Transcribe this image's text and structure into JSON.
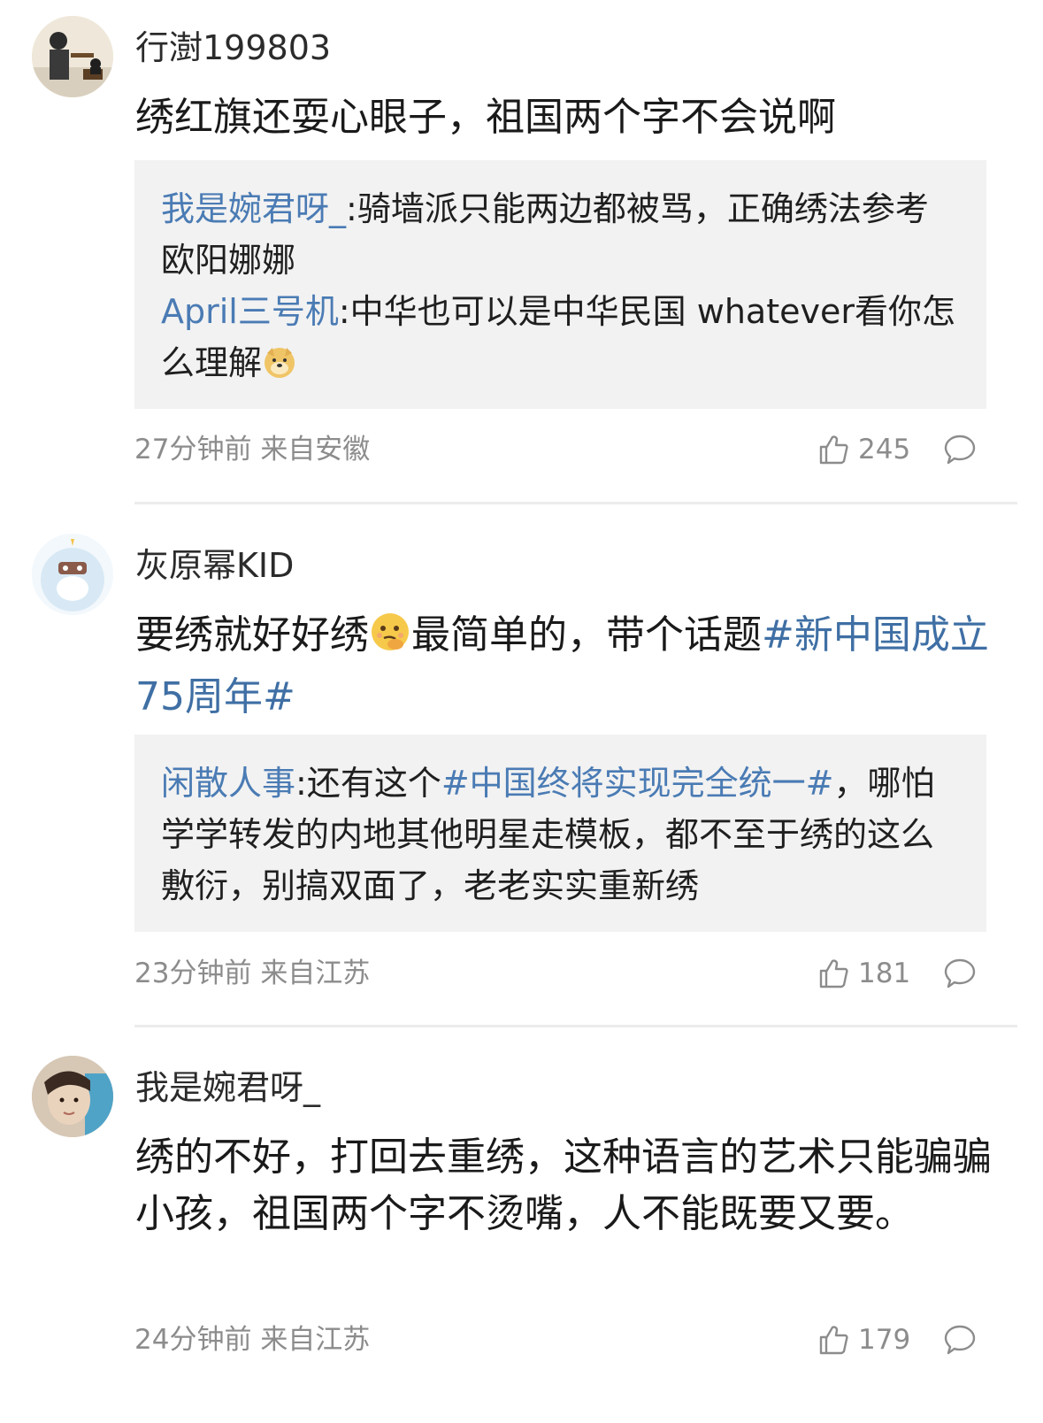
{
  "comments": [
    {
      "username": "行澍199803",
      "text": "绣红旗还耍心眼子，祖国两个字不会说啊",
      "replies": [
        {
          "author": "我是婉君呀_",
          "text": ":骑墙派只能两边都被骂，正确绣法参考欧阳娜娜"
        },
        {
          "author": "April三号机",
          "text": ":中华也可以是中华民国 whatever看你怎么理解",
          "emoji": "doge-emoji"
        }
      ],
      "time": "27分钟前",
      "location": "来自安徽",
      "likes": "245"
    },
    {
      "username": "灰原幂KID",
      "text_before": "要绣就好好绣",
      "emoji": "think-emoji",
      "text_after": "最简单的，带个话题",
      "topic": "#新中国成立75周年#",
      "replies": [
        {
          "author": "闲散人事",
          "text_before": ":还有这个",
          "topic": "#中国终将实现完全统一#",
          "text_after": "，哪怕学学转发的内地其他明星走模板，都不至于绣的这么敷衍，别搞双面了，老老实实重新绣"
        }
      ],
      "time": "23分钟前",
      "location": "来自江苏",
      "likes": "181"
    },
    {
      "username": "我是婉君呀_",
      "text": "绣的不好，打回去重绣，这种语言的艺术只能骗骗小孩，祖国两个字不烫嘴，人不能既要又要。",
      "time": "24分钟前",
      "location": "来自江苏",
      "likes": "179"
    }
  ],
  "colors": {
    "link": "#4a7bb4",
    "meta": "#8c8c8c",
    "reply_bg": "#f2f2f2"
  },
  "icons": [
    "like-icon",
    "comment-icon"
  ]
}
